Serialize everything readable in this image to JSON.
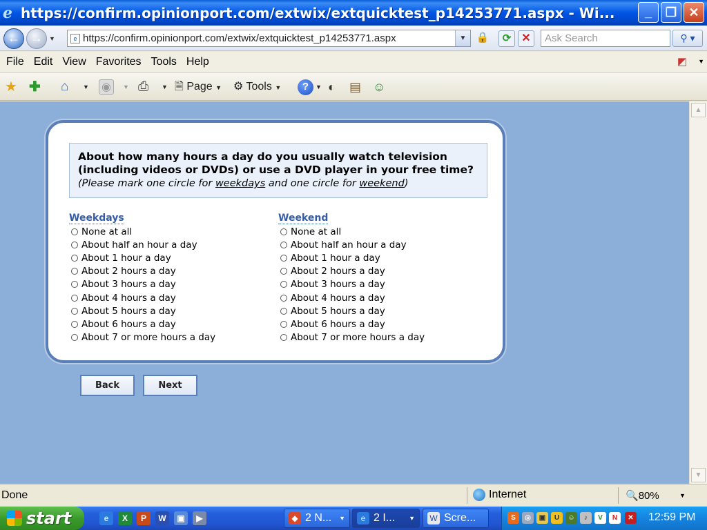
{
  "window": {
    "title": "https://confirm.opinionport.com/extwix/extquicktest_p14253771.aspx - Wi...",
    "min_label": "_",
    "max_label": "❐",
    "close_label": "✕"
  },
  "address": {
    "url": "https://confirm.opinionport.com/extwix/extquicktest_p14253771.aspx",
    "search_placeholder": "Ask Search",
    "back_glyph": "←",
    "forward_glyph": "→"
  },
  "menu": {
    "items": [
      "File",
      "Edit",
      "View",
      "Favorites",
      "Tools",
      "Help"
    ]
  },
  "commandbar": {
    "page_label": "Page",
    "tools_label": "Tools",
    "help_glyph": "?"
  },
  "survey": {
    "question_bold": "About how many hours a day do you usually watch television (including videos or DVDs) or use a DVD player in your free time?",
    "instruction_pre": "(Please mark one circle for ",
    "instruction_weekdays": "weekdays",
    "instruction_mid": " and one circle for ",
    "instruction_weekend": "weekend",
    "instruction_post": ")",
    "weekdays": {
      "heading": "Weekdays",
      "options": [
        "None at all",
        "About half an hour a day",
        "About 1 hour a day",
        "About 2 hours a day",
        "About 3 hours a day",
        "About 4 hours a day",
        "About 5 hours a day",
        "About 6 hours a day",
        "About 7 or more hours a day"
      ]
    },
    "weekend": {
      "heading": "Weekend",
      "options": [
        "None at all",
        "About half an hour a day",
        "About 1 hour a day",
        "About 2 hours a day",
        "About 3 hours a day",
        "About 4 hours a day",
        "About 5 hours a day",
        "About 6 hours a day",
        "About 7 or more hours a day"
      ]
    },
    "back_label": "Back",
    "next_label": "Next"
  },
  "status": {
    "text": "Done",
    "zone": "Internet",
    "zoom": "80%"
  },
  "taskbar": {
    "start_label": "start",
    "tasks": [
      {
        "label": "2 N..."
      },
      {
        "label": "2 I..."
      },
      {
        "label": "Scre..."
      }
    ],
    "clock": "12:59 PM"
  },
  "colors": {
    "content_bg": "#8cafd9",
    "card_border": "#5a7fb8",
    "heading": "#355da6"
  }
}
